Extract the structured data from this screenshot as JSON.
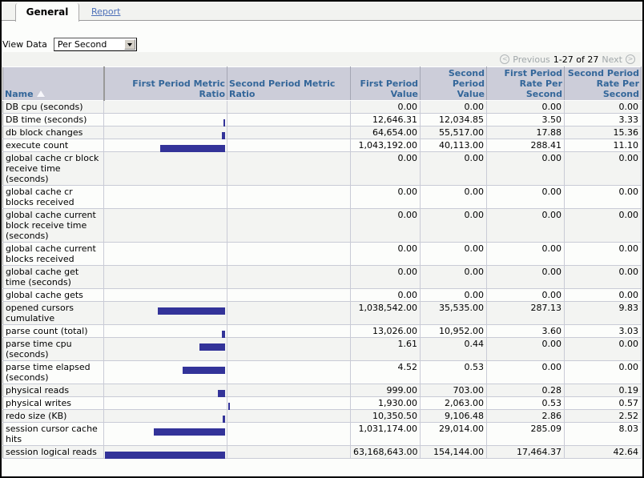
{
  "tabs": [
    {
      "label": "General",
      "active": true
    },
    {
      "label": "Report",
      "active": false
    }
  ],
  "view_data": {
    "label": "View Data",
    "selected": "Per Second"
  },
  "pager": {
    "previous": "Previous",
    "range": "1-27 of 27",
    "next": "Next"
  },
  "table": {
    "columns": [
      "Name",
      "First Period Metric Ratio",
      "Second Period Metric Ratio",
      "First Period Value",
      "Second Period Value",
      "First Period Rate Per Second",
      "Second Period Rate Per Second"
    ],
    "sort": {
      "column": "Name",
      "direction": "ascending"
    },
    "bar_color": "#333399",
    "rows": [
      {
        "name": "DB cpu (seconds)",
        "ratio1": 0,
        "ratio2": 0,
        "v1": "0.00",
        "v2": "0.00",
        "r1": "0.00",
        "r2": "0.00"
      },
      {
        "name": "DB time (seconds)",
        "ratio1": 0.004,
        "ratio2": 0,
        "v1": "12,646.31",
        "v2": "12,034.85",
        "r1": "3.50",
        "r2": "3.33"
      },
      {
        "name": "db block changes",
        "ratio1": 0.026,
        "ratio2": 0,
        "v1": "64,654.00",
        "v2": "55,517.00",
        "r1": "17.88",
        "r2": "15.36"
      },
      {
        "name": "execute count",
        "ratio1": 0.54,
        "ratio2": 0,
        "v1": "1,043,192.00",
        "v2": "40,113.00",
        "r1": "288.41",
        "r2": "11.10"
      },
      {
        "name": "global cache cr block receive time (seconds)",
        "ratio1": 0,
        "ratio2": 0,
        "v1": "0.00",
        "v2": "0.00",
        "r1": "0.00",
        "r2": "0.00"
      },
      {
        "name": "global cache cr blocks received",
        "ratio1": 0,
        "ratio2": 0,
        "v1": "0.00",
        "v2": "0.00",
        "r1": "0.00",
        "r2": "0.00"
      },
      {
        "name": "global cache current block receive time (seconds)",
        "ratio1": 0,
        "ratio2": 0,
        "v1": "0.00",
        "v2": "0.00",
        "r1": "0.00",
        "r2": "0.00"
      },
      {
        "name": "global cache current blocks received",
        "ratio1": 0,
        "ratio2": 0,
        "v1": "0.00",
        "v2": "0.00",
        "r1": "0.00",
        "r2": "0.00"
      },
      {
        "name": "global cache get time (seconds)",
        "ratio1": 0,
        "ratio2": 0,
        "v1": "0.00",
        "v2": "0.00",
        "r1": "0.00",
        "r2": "0.00"
      },
      {
        "name": "global cache gets",
        "ratio1": 0,
        "ratio2": 0,
        "v1": "0.00",
        "v2": "0.00",
        "r1": "0.00",
        "r2": "0.00"
      },
      {
        "name": "opened cursors cumulative",
        "ratio1": 0.56,
        "ratio2": 0,
        "v1": "1,038,542.00",
        "v2": "35,535.00",
        "r1": "287.13",
        "r2": "9.83"
      },
      {
        "name": "parse count (total)",
        "ratio1": 0.026,
        "ratio2": 0,
        "v1": "13,026.00",
        "v2": "10,952.00",
        "r1": "3.60",
        "r2": "3.03"
      },
      {
        "name": "parse time cpu (seconds)",
        "ratio1": 0.21,
        "ratio2": 0,
        "v1": "1.61",
        "v2": "0.44",
        "r1": "0.00",
        "r2": "0.00"
      },
      {
        "name": "parse time elapsed (seconds)",
        "ratio1": 0.35,
        "ratio2": 0,
        "v1": "4.52",
        "v2": "0.53",
        "r1": "0.00",
        "r2": "0.00"
      },
      {
        "name": "physical reads",
        "ratio1": 0.06,
        "ratio2": 0,
        "v1": "999.00",
        "v2": "703.00",
        "r1": "0.28",
        "r2": "0.19"
      },
      {
        "name": "physical writes",
        "ratio1": 0,
        "ratio2": 0.013,
        "v1": "1,930.00",
        "v2": "2,063.00",
        "r1": "0.53",
        "r2": "0.57"
      },
      {
        "name": "redo size (KB)",
        "ratio1": 0.02,
        "ratio2": 0,
        "v1": "10,350.50",
        "v2": "9,106.48",
        "r1": "2.86",
        "r2": "2.52"
      },
      {
        "name": "session cursor cache hits",
        "ratio1": 0.59,
        "ratio2": 0,
        "v1": "1,031,174.00",
        "v2": "29,014.00",
        "r1": "285.09",
        "r2": "8.03"
      },
      {
        "name": "session logical reads",
        "ratio1": 1.0,
        "ratio2": 0,
        "v1": "63,168,643.00",
        "v2": "154,144.00",
        "r1": "17,464.37",
        "r2": "42.64"
      }
    ]
  }
}
